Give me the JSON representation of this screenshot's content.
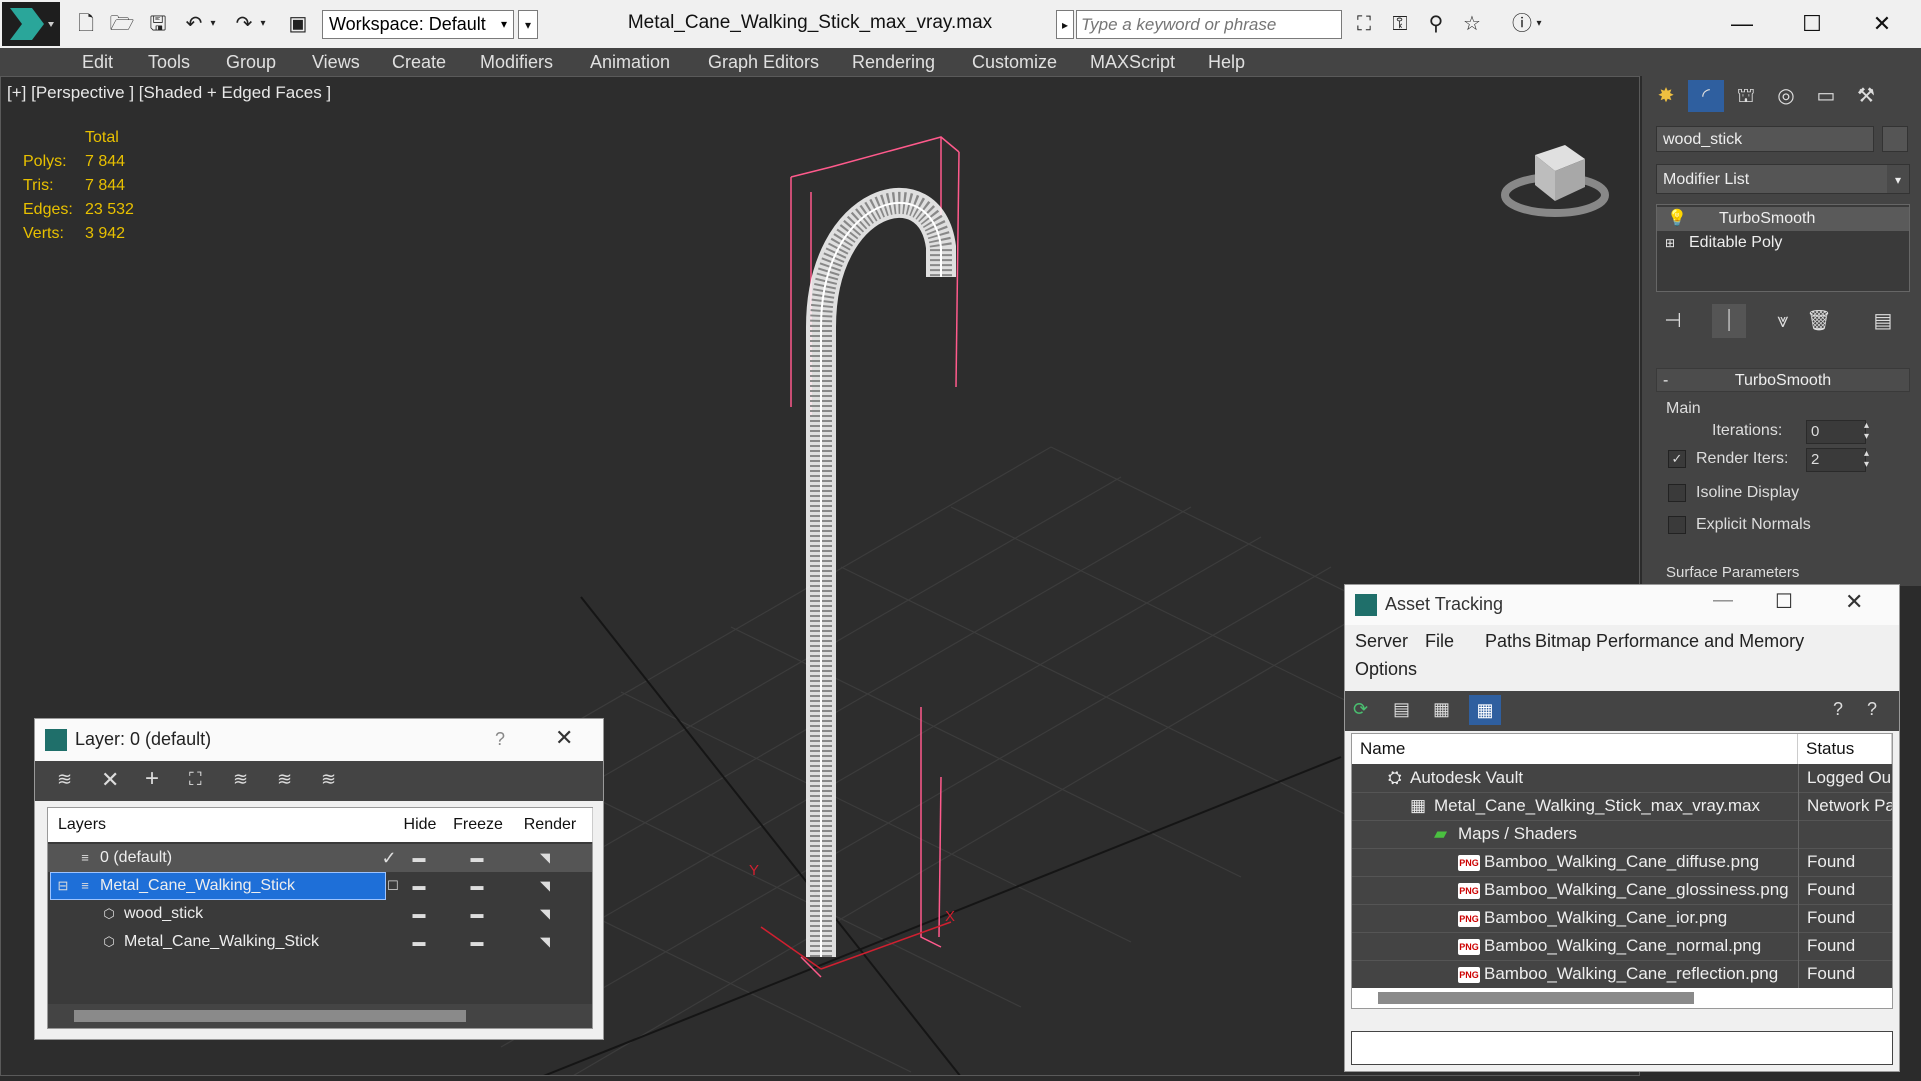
{
  "titlebar": {
    "workspace": "Workspace: Default",
    "file_title": "Metal_Cane_Walking_Stick_max_vray.max",
    "search_placeholder": "Type a keyword or phrase"
  },
  "menu": [
    "Edit",
    "Tools",
    "Group",
    "Views",
    "Create",
    "Modifiers",
    "Animation",
    "Graph Editors",
    "Rendering",
    "Customize",
    "MAXScript",
    "Help"
  ],
  "viewport": {
    "label": "[+] [Perspective ] [Shaded + Edged Faces ]",
    "stats_header": "Total",
    "stats": [
      {
        "label": "Polys:",
        "value": "7 844"
      },
      {
        "label": "Tris:",
        "value": "7 844"
      },
      {
        "label": "Edges:",
        "value": "23 532"
      },
      {
        "label": "Verts:",
        "value": "3 942"
      }
    ],
    "axis_x": "X",
    "axis_y": "Y"
  },
  "command_panel": {
    "object_name": "wood_stick",
    "modifier_list": "Modifier List",
    "stack": [
      "TurboSmooth",
      "Editable Poly"
    ],
    "rollout_title": "TurboSmooth",
    "group_main": "Main",
    "iterations_label": "Iterations:",
    "iterations_value": "0",
    "render_iters_label": "Render Iters:",
    "render_iters_value": "2",
    "isoline": "Isoline Display",
    "explicit_normals": "Explicit Normals",
    "surface_params": "Surface Parameters"
  },
  "layer_dialog": {
    "title": "Layer: 0 (default)",
    "help": "?",
    "columns": [
      "Layers",
      "Hide",
      "Freeze",
      "Render"
    ],
    "rows": [
      {
        "name": "0 (default)"
      },
      {
        "name": "Metal_Cane_Walking_Stick"
      },
      {
        "name": "wood_stick"
      },
      {
        "name": "Metal_Cane_Walking_Stick"
      }
    ]
  },
  "asset_tracking": {
    "title": "Asset Tracking",
    "menu": [
      "Server",
      "File",
      "Paths",
      "Bitmap Performance and Memory",
      "Options"
    ],
    "columns": [
      "Name",
      "Status"
    ],
    "rows": [
      {
        "name": "Autodesk Vault",
        "status": "Logged Ou"
      },
      {
        "name": "Metal_Cane_Walking_Stick_max_vray.max",
        "status": "Network Pa"
      },
      {
        "name": "Maps / Shaders",
        "status": ""
      },
      {
        "name": "Bamboo_Walking_Cane_diffuse.png",
        "status": "Found"
      },
      {
        "name": "Bamboo_Walking_Cane_glossiness.png",
        "status": "Found"
      },
      {
        "name": "Bamboo_Walking_Cane_ior.png",
        "status": "Found"
      },
      {
        "name": "Bamboo_Walking_Cane_normal.png",
        "status": "Found"
      },
      {
        "name": "Bamboo_Walking_Cane_reflection.png",
        "status": "Found"
      }
    ],
    "png_badge": "PNG"
  },
  "colors": {
    "selection_blue": "#1e6fd8",
    "stats_yellow": "#e8c000",
    "bbox_pink": "#ff5a8c"
  }
}
